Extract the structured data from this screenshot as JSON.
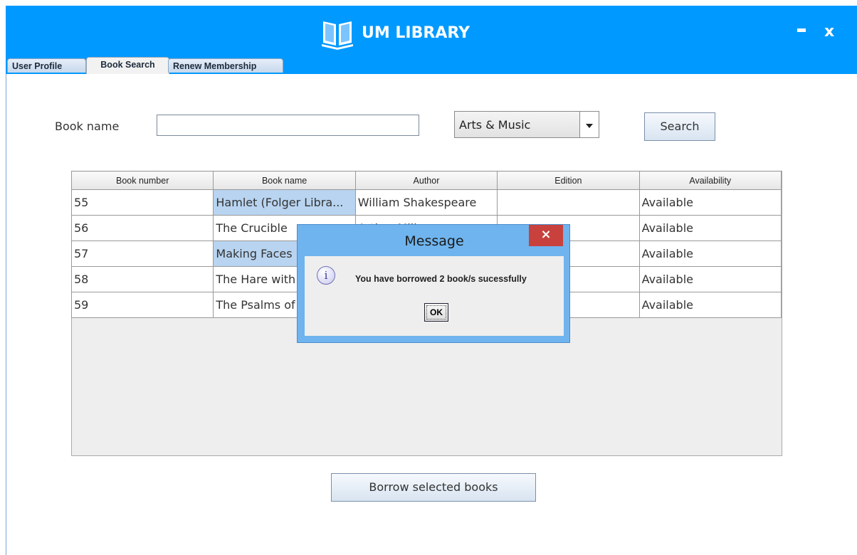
{
  "app": {
    "title": "UM LIBRARY",
    "minimize": "-",
    "close": "x"
  },
  "tabs": [
    {
      "label": "User Profile",
      "active": false
    },
    {
      "label": "Book Search",
      "active": true
    },
    {
      "label": "Renew Membership",
      "active": false
    }
  ],
  "search": {
    "label": "Book name",
    "value": "",
    "category": "Arts & Music",
    "button": "Search"
  },
  "table": {
    "columns": [
      "Book number",
      "Book name",
      "Author",
      "Edition",
      "Availability"
    ],
    "rows": [
      {
        "number": "55",
        "name": "Hamlet (Folger Libra...",
        "author": "William Shakespeare",
        "edition": "",
        "availability": "Available",
        "selected": true
      },
      {
        "number": "56",
        "name": "The Crucible",
        "author": "Arthur Mill",
        "edition": "",
        "availability": "Available",
        "selected": false
      },
      {
        "number": "57",
        "name": "Making Faces",
        "author": "",
        "edition": "",
        "availability": "Available",
        "selected": true
      },
      {
        "number": "58",
        "name": "The Hare with",
        "author": "",
        "edition": "",
        "availability": "Available",
        "selected": false
      },
      {
        "number": "59",
        "name": "The Psalms of",
        "author": "",
        "edition": "",
        "availability": "Available",
        "selected": false
      }
    ]
  },
  "borrow_button": "Borrow selected books",
  "dialog": {
    "title": "Message",
    "close": "×",
    "icon": "i",
    "message": "You have borrowed 2 book/s sucessfully",
    "ok": "OK"
  },
  "colors": {
    "titlebar": "#0099ff",
    "selection": "#b8d4f0",
    "dialog_frame": "#6fb4ee",
    "dialog_close": "#c8413c"
  }
}
